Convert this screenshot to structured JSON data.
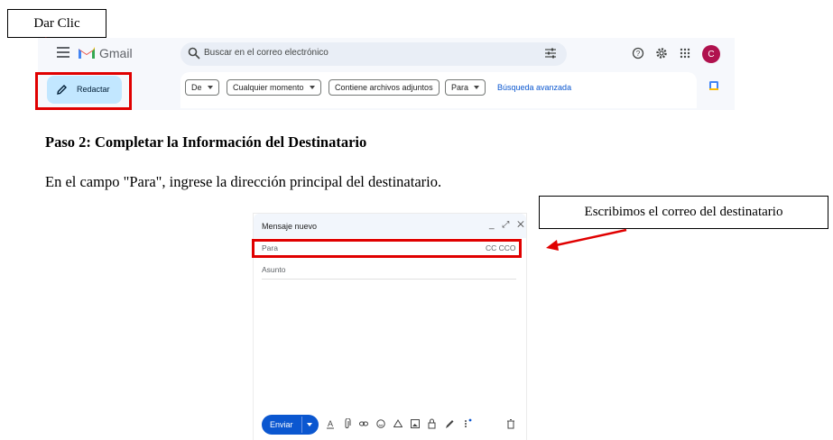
{
  "callouts": {
    "click": "Dar Clic",
    "recipient": "Escribimos el correo del destinatario"
  },
  "gmail": {
    "app_name": "Gmail",
    "search_placeholder": "Buscar en el correo electrónico",
    "avatar_letter": "C",
    "compose_label": "Redactar",
    "filters": [
      {
        "label": "De"
      },
      {
        "label": "Cualquier momento"
      },
      {
        "label": "Contiene archivos adjuntos"
      },
      {
        "label": "Para"
      }
    ],
    "advanced_search": "Búsqueda avanzada",
    "accent": "#0b57d0",
    "highlight": "#e00000"
  },
  "document": {
    "heading": "Paso 2: Completar la Información del Destinatario",
    "body": "En el campo \"Para\", ingrese la dirección principal del destinatario."
  },
  "compose": {
    "title": "Mensaje nuevo",
    "controls": "_ ⤢ ✕",
    "to_label": "Para",
    "cc_bcc": "CC CCO",
    "subject_label": "Asunto",
    "send_label": "Enviar",
    "toolbar_icons": [
      "format-text-icon",
      "attach-icon",
      "link-icon",
      "emoji-icon",
      "drive-icon",
      "photo-icon",
      "lock-clock-icon",
      "signature-icon",
      "more-options-icon",
      "trash-icon"
    ]
  }
}
